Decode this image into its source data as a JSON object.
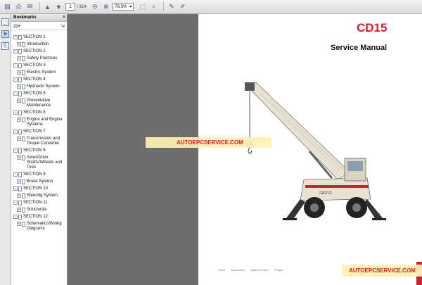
{
  "toolbar": {
    "page_current": "1",
    "page_total": "/ 314",
    "zoom": "78.5%",
    "icons": [
      "open-icon",
      "print-icon",
      "email-icon",
      "search-icon",
      "prev-page-icon",
      "next-page-icon",
      "zoom-out-icon",
      "zoom-in-icon",
      "fit-page-icon",
      "comment-icon",
      "highlight-icon"
    ]
  },
  "bookmarks": {
    "header": "Bookmarks",
    "items": [
      {
        "label": "SECTION 1",
        "level": 0
      },
      {
        "label": "Introduction",
        "level": 1
      },
      {
        "label": "SECTION 2",
        "level": 0
      },
      {
        "label": "Safety Practices",
        "level": 1
      },
      {
        "label": "SECTION 3",
        "level": 0
      },
      {
        "label": "Electric System",
        "level": 1
      },
      {
        "label": "SECTION 4",
        "level": 0
      },
      {
        "label": "Hydraulic System",
        "level": 1
      },
      {
        "label": "SECTION 5",
        "level": 0
      },
      {
        "label": "Preventative Maintenance",
        "level": 1
      },
      {
        "label": "SECTION 6",
        "level": 0
      },
      {
        "label": "Engine and Engine Systems",
        "level": 1
      },
      {
        "label": "SECTION 7",
        "level": 0
      },
      {
        "label": "Transmission and Torque Converter",
        "level": 1
      },
      {
        "label": "SECTION 8",
        "level": 0
      },
      {
        "label": "Axles/Drive Shafts/Wheels and Tires",
        "level": 1
      },
      {
        "label": "SECTION 9",
        "level": 0
      },
      {
        "label": "Brake System",
        "level": 1
      },
      {
        "label": "SECTION 10",
        "level": 0
      },
      {
        "label": "Steering System",
        "level": 1
      },
      {
        "label": "SECTION 11",
        "level": 0
      },
      {
        "label": "Structurals",
        "level": 1
      },
      {
        "label": "SECTION 12",
        "level": 0
      },
      {
        "label": "Schematics/Wiring Diagrams",
        "level": 1
      }
    ]
  },
  "document": {
    "model": "CD15",
    "title": "Service Manual",
    "footer": [
      "Grove",
      "Manitowoc",
      "National Crane",
      "Potain"
    ],
    "crane_brand": "GROVE",
    "crane_model_mark": "CD15"
  },
  "watermarks": {
    "center": "AUTOEPCSERVICE.COM",
    "bottom": "AUTOEPCSERVICE.COM"
  },
  "colors": {
    "brand_red": "#d3202a",
    "crane_body": "#e8e2d2",
    "crane_accent": "#c0282d"
  }
}
